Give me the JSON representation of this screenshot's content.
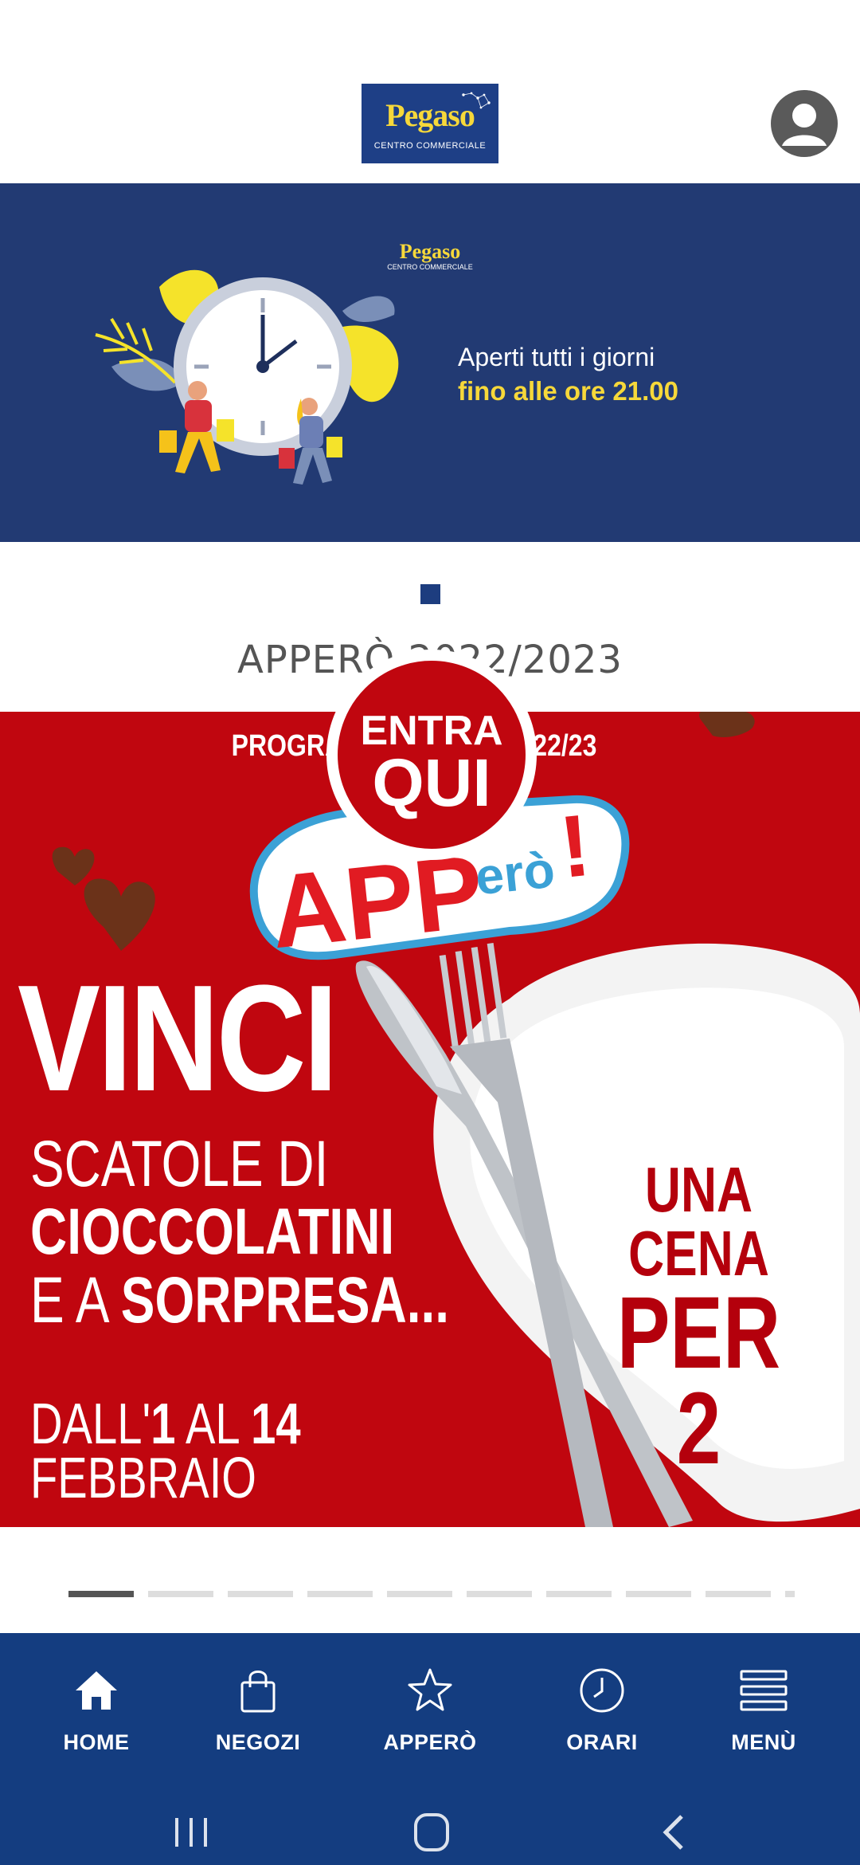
{
  "header": {
    "logo": {
      "brand": "Pegaso",
      "subtitle": "CENTRO COMMERCIALE"
    },
    "account_icon": "account-circle-icon"
  },
  "hours_banner": {
    "logo": {
      "brand": "Pegaso",
      "subtitle": "CENTRO COMMERCIALE"
    },
    "line1": "Aperti tutti i giorni",
    "line2": "fino alle ore 21.00"
  },
  "carousel": {
    "active_index": 0,
    "count": 1
  },
  "section": {
    "title": "APPERÒ 2022/2023"
  },
  "promo": {
    "program": "PROGRAMMA FEDELTÀ 22/23",
    "logo_text": {
      "app": "APP",
      "ero": "erò",
      "excl": "!"
    },
    "vinci": "VINCI",
    "line1": "SCATOLE DI",
    "line2": "CIOCCOLATINI",
    "line3_prefix": "E A ",
    "line3_bold": "SORPRESA...",
    "dates": {
      "prefix": "DALL'",
      "day1": "1",
      "mid": " AL ",
      "day2": "14",
      "month": "FEBBRAIO"
    },
    "cena_line1": "UNA CENA",
    "cena_line2": "PER 2",
    "cta_line1": "ENTRA",
    "cta_line2": "QUI"
  },
  "pager": {
    "total": 10,
    "active_index": 0
  },
  "bottom_nav": {
    "items": [
      {
        "label": "HOME",
        "icon": "home-icon"
      },
      {
        "label": "NEGOZI",
        "icon": "shopping-bag-icon"
      },
      {
        "label": "APPERÒ",
        "icon": "star-icon"
      },
      {
        "label": "ORARI",
        "icon": "clock-icon"
      },
      {
        "label": "MENÙ",
        "icon": "menu-icon"
      }
    ]
  },
  "system_nav": [
    "recents-icon",
    "home-circle-icon",
    "back-icon"
  ],
  "colors": {
    "navy": "#223a73",
    "nav_blue": "#143d80",
    "promo_red": "#c0060f",
    "accent_yellow": "#f6d83a"
  }
}
